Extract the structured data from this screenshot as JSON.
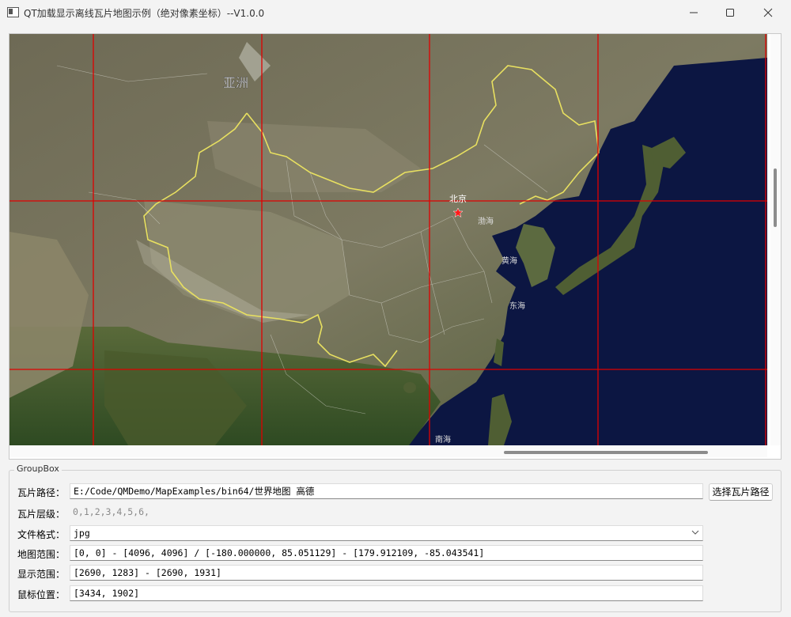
{
  "window": {
    "title": "QT加载显示离线瓦片地图示例（绝对像素坐标）--V1.0.0"
  },
  "map": {
    "labels": {
      "continent": "亚洲",
      "capital": "北京",
      "sea1": "渤海",
      "sea2": "黄海",
      "sea3": "东海",
      "sea4": "南海"
    },
    "grid_color": "#e00000",
    "border_color": "#e8e060",
    "capital_marker": "red-star-icon"
  },
  "groupbox": {
    "title": "GroupBox",
    "rows": [
      {
        "label": "瓦片路径：",
        "value": "E:/Code/QMDemo/MapExamples/bin64/世界地图 高德"
      },
      {
        "label": "瓦片层级：",
        "value": "0,1,2,3,4,5,6,"
      },
      {
        "label": "文件格式：",
        "value": "jpg"
      },
      {
        "label": "地图范围：",
        "value": "[0, 0] - [4096, 4096] / [-180.000000, 85.051129] - [179.912109, -85.043541]"
      },
      {
        "label": "显示范围：",
        "value": "[2690, 1283] - [2690, 1931]"
      },
      {
        "label": "鼠标位置：",
        "value": "[3434, 1902]"
      }
    ],
    "select_button": "选择瓦片路径"
  }
}
